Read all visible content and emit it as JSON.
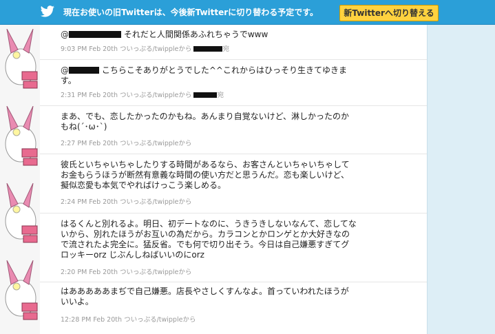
{
  "banner": {
    "message": "現在お使いの旧Twitterは、今後新Twitterに切り替わる予定です。",
    "switch_button": "新Twitterへ切り替える",
    "logo_icon": "twitter-bird-icon",
    "colors": {
      "background": "#2b9fd8",
      "button": "#ffd23f"
    }
  },
  "tweets": [
    {
      "mention_prefix": "@",
      "text": "それだと人間関係あふれちゃうでwww",
      "time": "9:03 PM Feb 20th",
      "via": "ついっぷる/twippleから",
      "reply_suffix": "宛"
    },
    {
      "mention_prefix": "@",
      "text": "こちらこそありがとうでした^^これからはひっそり生きてゆきます。",
      "time": "2:31 PM Feb 20th",
      "via": "ついっぷる/twippleから",
      "reply_suffix": "宛"
    },
    {
      "text": "まあ、でも、恋したかったのかもね。あんまり自覚ないけど、淋しかったのかもね(´･ω･`)",
      "time": "2:27 PM Feb 20th",
      "via": "ついっぷる/twippleから"
    },
    {
      "text": "彼氏といちゃいちゃしたりする時間があるなら、お客さんといちゃいちゃしてお金もらうほうが断然有意義な時間の使い方だと思うんだ。恋も楽しいけど、擬似恋愛も本気でやればけっこう楽しめる。",
      "time": "2:24 PM Feb 20th",
      "via": "ついっぷる/twippleから"
    },
    {
      "text": "はるくんと別れるよ。明日、初デートなのに、うきうきしないなんて、恋してないから、別れたほうがお互いの為だから。カラコンとかロンゲとか大好きなので流されたよ完全に。猛反省。でも何で切り出そう。今日は自己嫌悪すぎてグロッキーorz じぶんしねばいいのにorz",
      "time": "2:20 PM Feb 20th",
      "via": "ついっぷる/twippleから"
    },
    {
      "text": "はあああああまぢで自己嫌悪。店長やさしくすんなよ。首っていわれたほうがいいよ。",
      "time": "12:28 PM Feb 20th",
      "via": "ついっぷる/twippleから"
    }
  ]
}
